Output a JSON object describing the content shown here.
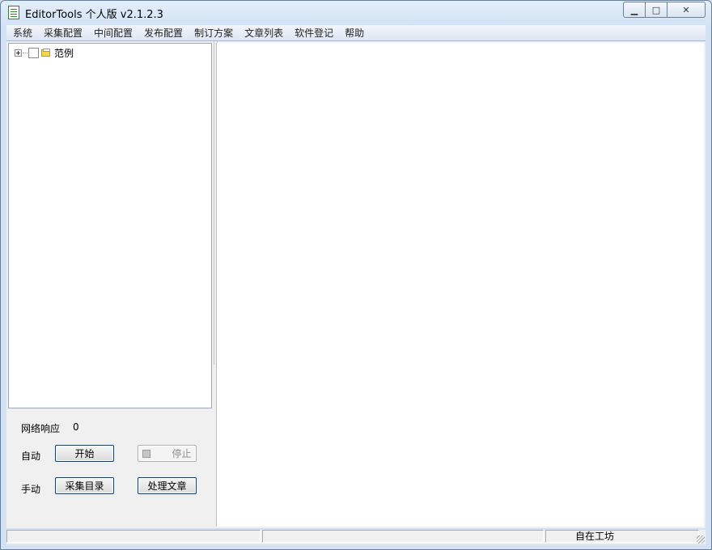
{
  "window": {
    "title": "EditorTools 个人版 v2.1.2.3",
    "minimize_glyph": "▁",
    "maximize_glyph": "□",
    "close_glyph": "✕"
  },
  "menu": [
    "系统",
    "采集配置",
    "中间配置",
    "发布配置",
    "制订方案",
    "文章列表",
    "软件登记",
    "帮助"
  ],
  "tree": {
    "root_label": "范例",
    "expander_state": "collapsed",
    "checked": false
  },
  "controls": {
    "network_label": "网络响应",
    "network_value": "0",
    "auto_label": "自动",
    "start_button": "开始",
    "stop_button": "停止",
    "manual_label": "手动",
    "collect_dir_button": "采集目录",
    "process_article_button": "处理文章"
  },
  "status": {
    "pane1": "",
    "pane2": "",
    "pane3": "自在工坊"
  },
  "icons": {
    "app": "document-icon",
    "folder": "folder-icon",
    "stop": "stop-square-icon"
  },
  "colors": {
    "titlebar": "#dce8f5",
    "menubar": "#e6edf7",
    "button_border": "#1c3e63",
    "panel_bg": "#f0f0f0"
  }
}
